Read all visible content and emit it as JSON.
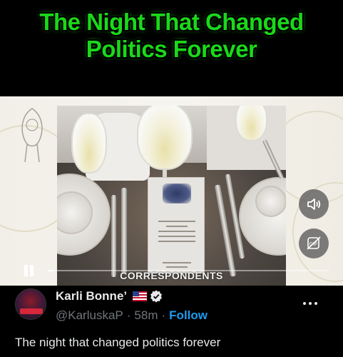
{
  "video": {
    "title_line_1": "The Night That Changed",
    "title_line_2": "Politics Forever",
    "photo_caption": "CORRESPONDENTS",
    "menu_card_lines": [
      "Annual Dinner",
      "of the",
      "White House",
      "Correspondents'",
      "Association"
    ],
    "progress_fraction": 0.02
  },
  "post": {
    "author_name": "Karli Bonne’",
    "handle": "@KarluskaP",
    "separator": "·",
    "time": "58m",
    "follow_label": "Follow",
    "text": "The night that changed politics forever"
  },
  "colors": {
    "title_green": "#1ad91a",
    "follow_blue": "#1d9bf0",
    "muted_gray": "#71767b"
  },
  "icons": [
    "pause-icon",
    "volume-icon",
    "gif-icon",
    "verified-icon",
    "us-flag-icon",
    "more-icon"
  ]
}
